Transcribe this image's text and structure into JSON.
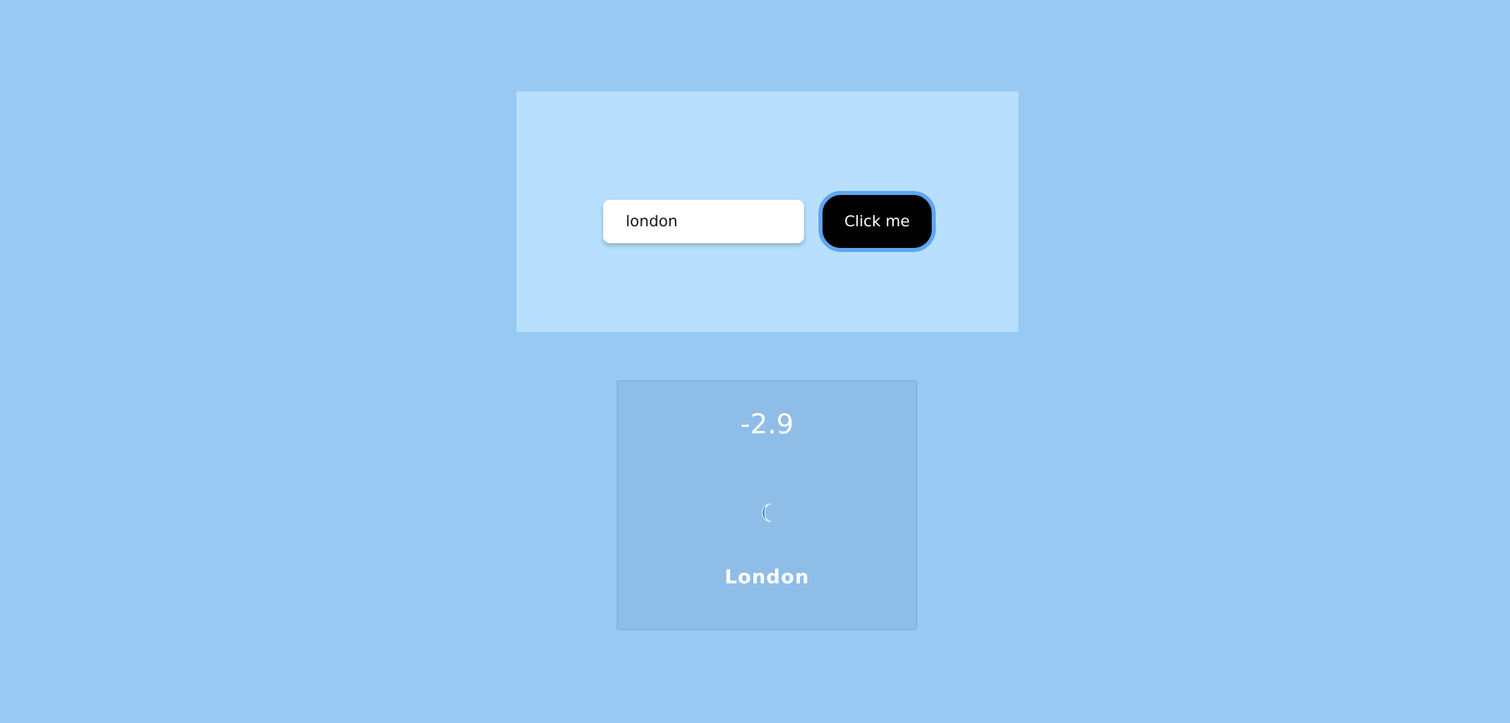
{
  "search": {
    "input_value": "london",
    "button_label": "Click me"
  },
  "weather": {
    "temperature": "-2.9",
    "condition_icon": "crescent-moon-icon",
    "city": "London"
  },
  "colors": {
    "page_background": "#97c9f2",
    "panel_background": "#b8dffd",
    "card_background": "#8ebde8",
    "button_background": "#000000",
    "button_border": "#5ea6f2",
    "icon_color": "#1a6fc7"
  }
}
